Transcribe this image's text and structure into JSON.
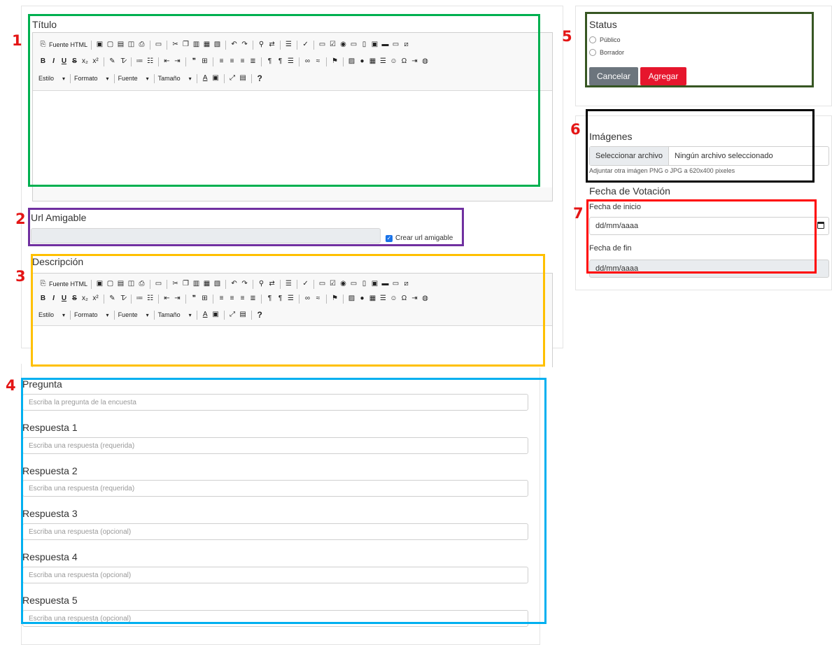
{
  "numbers": {
    "n1": "1",
    "n2": "2",
    "n3": "3",
    "n4": "4",
    "n5": "5",
    "n6": "6",
    "n7": "7"
  },
  "titulo": {
    "label": "Título"
  },
  "toolbar": {
    "source_label": "Fuente HTML",
    "style_label": "Estilo",
    "format_label": "Formato",
    "font_label": "Fuente",
    "size_label": "Tamaño",
    "help_label": "?"
  },
  "url": {
    "label": "Url Amigable",
    "checkbox_label": "Crear url amigable"
  },
  "descripcion": {
    "label": "Descripción"
  },
  "pregunta": {
    "label": "Pregunta",
    "placeholder": "Escriba la pregunta de la encuesta"
  },
  "respuestas": [
    {
      "label": "Respuesta 1",
      "placeholder": "Escriba una respuesta (requerida)"
    },
    {
      "label": "Respuesta 2",
      "placeholder": "Escriba una respuesta (requerida)"
    },
    {
      "label": "Respuesta 3",
      "placeholder": "Escriba una respuesta (opcional)"
    },
    {
      "label": "Respuesta 4",
      "placeholder": "Escriba una respuesta (opcional)"
    },
    {
      "label": "Respuesta 5",
      "placeholder": "Escriba una respuesta (opcional)"
    }
  ],
  "status": {
    "label": "Status",
    "option_publico": "Público",
    "option_borrador": "Borrador",
    "cancel_label": "Cancelar",
    "add_label": "Agregar"
  },
  "imagenes": {
    "label": "Imágenes",
    "select_file_label": "Seleccionar archivo",
    "no_file_label": "Ningún archivo seleccionado",
    "hint": "Adjuntar otra imágen PNG o JPG a 620x400 pixeles"
  },
  "votacion": {
    "label": "Fecha de Votación",
    "inicio_label": "Fecha de inicio",
    "inicio_value": "dd/mm/aaaa",
    "fin_label": "Fecha de fin",
    "fin_value": "dd/mm/aaaa"
  },
  "colors": {
    "box1": "#00b050",
    "box2": "#7030a0",
    "box3": "#ffc000",
    "box4": "#00b0f0",
    "box5": "#375623",
    "box6": "#000000",
    "box7": "#ff0000",
    "cancel": "#6c757d",
    "add": "#e6162d",
    "check": "#1a73e8"
  }
}
